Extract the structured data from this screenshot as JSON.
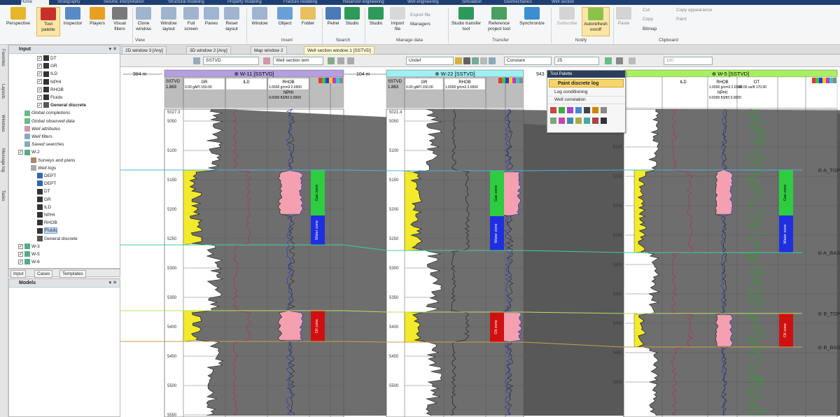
{
  "top_tabs": [
    "Home",
    "Stratigraphy",
    "Seismic interpretation",
    "Structural modeling",
    "Property modeling",
    "Fracture modeling",
    "Reservoir engineering",
    "Well engineering",
    "Simulation",
    "Geomechanics",
    "Well section"
  ],
  "ribbon": {
    "buttons": [
      "Perspective",
      "Tool palette",
      "Inspector",
      "Players",
      "Visual filters",
      "Clone window",
      "Window layout",
      "Full screen",
      "Panes",
      "Reset layout",
      "Window",
      "Object",
      "Folder",
      "Petrel",
      "Studio",
      "Studio",
      "Import file",
      "Studio transfer tool",
      "Reference project tool",
      "Synchronize",
      "Subscribe",
      "Autorefresh on/off",
      "Paste"
    ],
    "small": {
      "export_file": "Export file",
      "managers": "Managers",
      "cut": "Cut",
      "copy": "Copy",
      "bitmap": "Bitmap",
      "copy_appearance": "Copy appearance",
      "paint": "Paint"
    },
    "groups": [
      "View",
      "Insert",
      "Search",
      "Manage data",
      "Transfer",
      "Notify",
      "Clipboard"
    ]
  },
  "left_strip": [
    "Favorites",
    "Layouts",
    "Windows",
    "Message log",
    "Tasks"
  ],
  "input_pane": {
    "title": "Input",
    "items": [
      "DT",
      "GR",
      "ILD",
      "NPHI",
      "RHOB",
      "Fluids",
      "General discrete",
      "Global completions",
      "Global observed data",
      "Well attributes",
      "Well filters",
      "Saved searches",
      "W-2",
      "Surveys and plans",
      "Well logs",
      "DEPT",
      "DEPT",
      "DT",
      "GR",
      "ILD",
      "NPHI",
      "RHOB",
      "Fluids",
      "General discrete",
      "W-3",
      "W-5",
      "W-6"
    ],
    "tabs": [
      "Input",
      "Cases",
      "Templates"
    ]
  },
  "models_pane": {
    "title": "Models"
  },
  "doc_tabs": [
    "2D window 3 [Any]",
    "3D window 2 [Any]",
    "Map window 2",
    "Well section window 1 [SSTVD]"
  ],
  "window_toolbar": {
    "zdomain": "SSTVD",
    "template": "Well section tem",
    "undef": "Undef",
    "constant": "Constant",
    "size": "25",
    "zoom": "100"
  },
  "spacings": [
    "984 m",
    "104 m",
    "943"
  ],
  "wells": [
    {
      "name": "W-11 [SSTVD]",
      "header_color": "#b59fe0",
      "z_label": "SSTVD",
      "z_val": "1.863",
      "tracks": {
        "gr": "GR",
        "gr_scale": "0.00  gAPI  150.00",
        "ild": "ILD",
        "rhob": "RHOB",
        "rhob_scale": "1.6500 g/cm3 2.6500",
        "nphi": "NPHI",
        "nphi_scale": "0.6000 ft3/ft3 0.0000"
      },
      "depths": [
        "5027.3",
        "5050",
        "5100",
        "5150",
        "5200",
        "5250",
        "5300",
        "5350",
        "5400",
        "5450",
        "5500",
        "5550"
      ]
    },
    {
      "name": "W-22 [SSTVD]",
      "header_color": "#9ff0f3",
      "z_label": "SSTVD",
      "z_val": "1.863",
      "tracks": {
        "gr": "GR",
        "gr_scale": "0.00  gAPI  150.00",
        "rhob": "RHOB",
        "rhob_scale": "1.6500 g/cm3 2.6500"
      },
      "depths": [
        "5021.4",
        "5050",
        "5100",
        "5150",
        "5200",
        "5250",
        "5300",
        "5350",
        "5400",
        "5450",
        "5500"
      ]
    },
    {
      "name": "W-5 [SSTVD]",
      "header_color": "#a8f062",
      "tracks": {
        "ild": "ILD",
        "rhob": "RHOB",
        "rhob_scale": "1.6500 g/cm3 2.6500",
        "nphi": "NPHI",
        "nphi_scale": "0.6000 ft3/ft3 0.0000",
        "dt": "DT",
        "dt_scale": "80.00  us/ft  170.00"
      },
      "depths": [
        "5050",
        "5100",
        "5150",
        "5200",
        "5250",
        "5300",
        "5350",
        "5400",
        "5450",
        "5500"
      ]
    }
  ],
  "zones": [
    "Gas zone",
    "Water zone",
    "Oil zone"
  ],
  "horizons": [
    "A_TOP",
    "A_BASE",
    "B_TOP",
    "B_BASE"
  ],
  "palette": {
    "title": "Tool Palette",
    "selected": "Paint discrete log",
    "rows": [
      "Log conditioning",
      "Well correlation"
    ]
  },
  "colors": {
    "gas": "#2ecc40",
    "water": "#1f2fe0",
    "oil": "#d01010",
    "ribbon": "#1f3f72",
    "gr_fill": "#f2ea2a",
    "rhob_fill": "#f4a0b0"
  }
}
